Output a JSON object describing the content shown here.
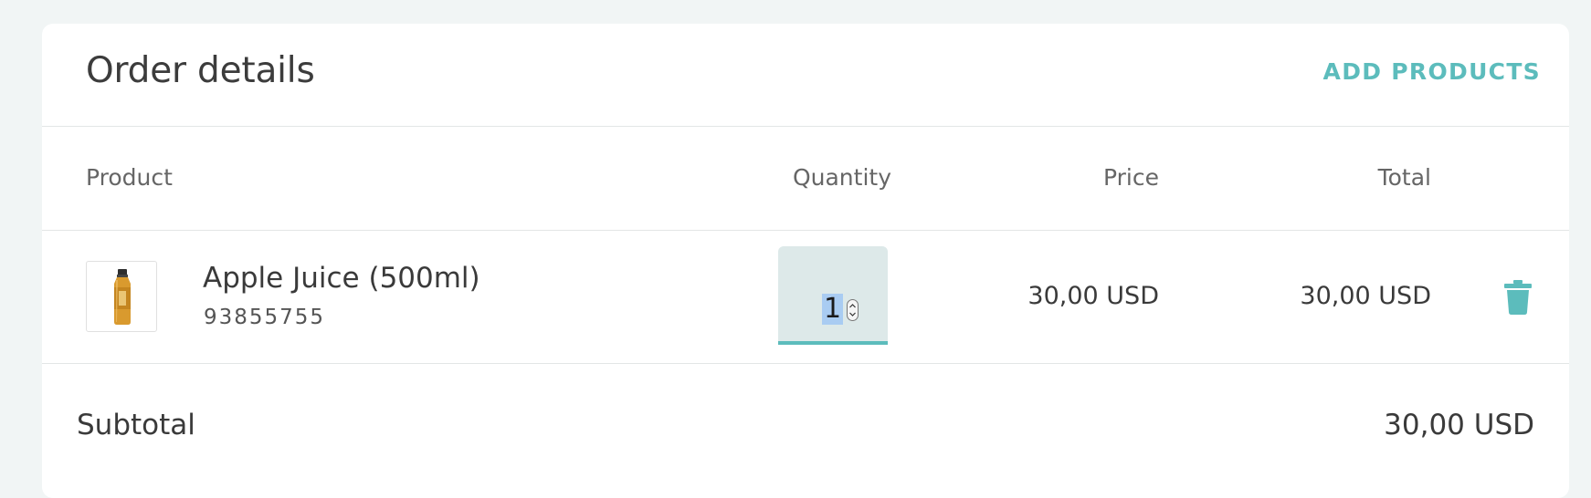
{
  "header": {
    "title": "Order details",
    "add_products_label": "ADD PRODUCTS"
  },
  "columns": {
    "product": "Product",
    "quantity": "Quantity",
    "price": "Price",
    "total": "Total"
  },
  "items": [
    {
      "name": "Apple Juice (500ml)",
      "sku": "93855755",
      "quantity": "1",
      "price": "30,00 USD",
      "total": "30,00 USD",
      "thumbnail_icon": "juice-bottle-icon"
    }
  ],
  "summary": {
    "subtotal_label": "Subtotal",
    "subtotal_value": "30,00 USD"
  },
  "colors": {
    "accent": "#5cbcbc",
    "background": "#f1f5f5",
    "card": "#ffffff",
    "qty_field": "#dde9e9",
    "selection": "#a9ccf2"
  },
  "icons": {
    "delete": "trash-icon",
    "spinner": "spinner-arrows-icon"
  }
}
